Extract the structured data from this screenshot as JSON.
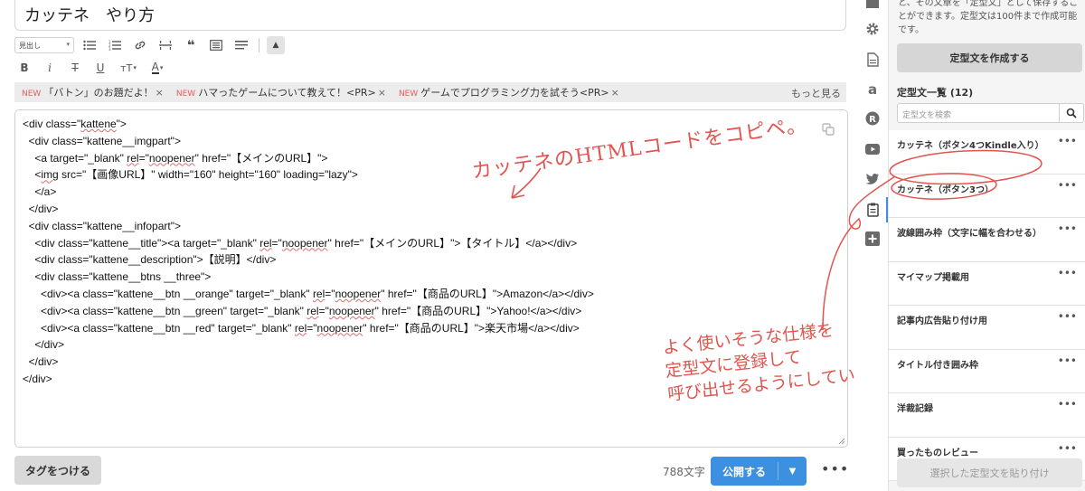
{
  "editor": {
    "title": "カッテネ　やり方",
    "toolbar": {
      "heading_select": "見出し",
      "row1_icons": [
        "unordered-list-icon",
        "ordered-list-icon",
        "link-icon",
        "horizontal-rule-icon",
        "quote-icon",
        "table-icon",
        "more-format-icon"
      ],
      "row2_labels": {
        "bold": "B",
        "italic": "i",
        "strike": "T",
        "underline": "U",
        "size": "тT",
        "color": "A"
      }
    },
    "suggestions": [
      {
        "badge": "NEW",
        "text": "「バトン」のお題だよ！"
      },
      {
        "badge": "NEW",
        "text": "ハマったゲームについて教えて！<PR>"
      },
      {
        "badge": "NEW",
        "text": "ゲームでプログラミング力を試そう<PR>"
      }
    ],
    "suggestion_close": "×",
    "more_link": "もっと見る",
    "code_lines": [
      "<div class=\"kattene\">",
      "  <div class=\"kattene__imgpart\">",
      "    <a target=\"_blank\" rel=\"noopener\" href=\"【メインのURL】\">",
      "    <img src=\"【画像URL】\" width=\"160\" height=\"160\" loading=\"lazy\">",
      "    </a>",
      "  </div>",
      "  <div class=\"kattene__infopart\">",
      "    <div class=\"kattene__title\"><a target=\"_blank\" rel=\"noopener\" href=\"【メインのURL】\">【タイトル】</a></div>",
      "    <div class=\"kattene__description\">【説明】</div>",
      "    <div class=\"kattene__btns __three\">",
      "      <div><a class=\"kattene__btn __orange\" target=\"_blank\" rel=\"noopener\" href=\"【商品のURL】\">Amazon</a></div>",
      "      <div><a class=\"kattene__btn __green\" target=\"_blank\" rel=\"noopener\" href=\"【商品のURL】\">Yahoo!</a></div>",
      "      <div><a class=\"kattene__btn __red\" target=\"_blank\" rel=\"noopener\" href=\"【商品のURL】\">楽天市場</a></div>",
      "    </div>",
      "  </div>",
      "</div>"
    ],
    "annotation_top": "カッテネのHTMLコードをコピペ。",
    "annotation_bottom": [
      "よく使いそうな仕様を",
      "定型文に登録して",
      "呼び出せるようにしています。"
    ]
  },
  "bottom": {
    "tag_button": "タグをつける",
    "char_count": "788文字",
    "publish_button": "公開する",
    "more": "•••"
  },
  "side_icons": [
    "square-icon",
    "gear-icon",
    "document-icon",
    "amazon-icon",
    "r-badge-icon",
    "youtube-icon",
    "twitter-icon",
    "clipboard-icon",
    "plus-icon"
  ],
  "panel": {
    "description": "と、その文章を「定型文」として保存することができます。定型文は100件まで作成可能です。",
    "create_button": "定型文を作成する",
    "list_title": "定型文一覧 (12)",
    "search_placeholder": "定型文を検索",
    "items": [
      "カッテネ（ボタン4つKindle入り）",
      "カッテネ（ボタン3つ）",
      "波線囲み枠（文字に幅を合わせる）",
      "マイマップ掲載用",
      "記事内広告貼り付け用",
      "タイトル付き囲み枠",
      "洋裁記録",
      "買ったものレビュー"
    ],
    "item_menu": "•••",
    "paste_button": "選択した定型文を貼り付け"
  },
  "colors": {
    "accent": "#3d8fe0",
    "annotation": "#e0554f",
    "new_badge": "#e85c5c"
  }
}
